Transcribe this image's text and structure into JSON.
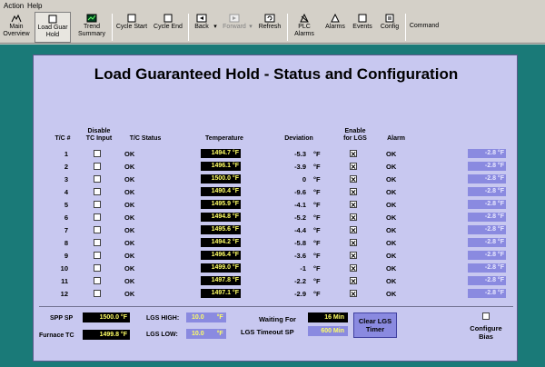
{
  "menu": {
    "action": "Action",
    "help": "Help"
  },
  "toolbar": [
    {
      "name": "main-overview",
      "l1": "Main",
      "l2": "Overview"
    },
    {
      "name": "load-guar-hold",
      "l1": "Load Guar",
      "l2": "Hold"
    },
    {
      "name": "trend-summary",
      "l1": "Trend",
      "l2": "Summary"
    },
    {
      "name": "cycle-start",
      "l1": "Cycle Start",
      "l2": ""
    },
    {
      "name": "cycle-end",
      "l1": "Cycle End",
      "l2": ""
    },
    {
      "name": "back",
      "l1": "Back",
      "l2": ""
    },
    {
      "name": "forward",
      "l1": "Forward",
      "l2": ""
    },
    {
      "name": "refresh",
      "l1": "Refresh",
      "l2": ""
    },
    {
      "name": "plc-alarms",
      "l1": "PLC",
      "l2": "Alarms"
    },
    {
      "name": "alarms",
      "l1": "Alarms",
      "l2": ""
    },
    {
      "name": "events",
      "l1": "Events",
      "l2": ""
    },
    {
      "name": "config",
      "l1": "Config",
      "l2": ""
    },
    {
      "name": "command",
      "l1": "Command",
      "l2": ""
    }
  ],
  "title": "Load Guaranteed Hold - Status and Configuration",
  "headers": {
    "tc": "T/C #",
    "disable": "Disable\nTC Input",
    "status": "T/C Status",
    "temperature": "Temperature",
    "deviation": "Deviation",
    "enable": "Enable\nfor LGS",
    "alarm": "Alarm"
  },
  "rows": [
    {
      "tc": "1",
      "status": "OK",
      "temp": "1494.7 °F",
      "dev": "-5.3",
      "alarm": "OK",
      "bias": "-2.8 °F"
    },
    {
      "tc": "2",
      "status": "OK",
      "temp": "1496.1 °F",
      "dev": "-3.9",
      "alarm": "OK",
      "bias": "-2.8 °F"
    },
    {
      "tc": "3",
      "status": "OK",
      "temp": "1500.0 °F",
      "dev": "0",
      "alarm": "OK",
      "bias": "-2.8 °F"
    },
    {
      "tc": "4",
      "status": "OK",
      "temp": "1490.4 °F",
      "dev": "-9.6",
      "alarm": "OK",
      "bias": "-2.8 °F"
    },
    {
      "tc": "5",
      "status": "OK",
      "temp": "1495.9 °F",
      "dev": "-4.1",
      "alarm": "OK",
      "bias": "-2.8 °F"
    },
    {
      "tc": "6",
      "status": "OK",
      "temp": "1494.8 °F",
      "dev": "-5.2",
      "alarm": "OK",
      "bias": "-2.8 °F"
    },
    {
      "tc": "7",
      "status": "OK",
      "temp": "1495.6 °F",
      "dev": "-4.4",
      "alarm": "OK",
      "bias": "-2.8 °F"
    },
    {
      "tc": "8",
      "status": "OK",
      "temp": "1494.2 °F",
      "dev": "-5.8",
      "alarm": "OK",
      "bias": "-2.8 °F"
    },
    {
      "tc": "9",
      "status": "OK",
      "temp": "1496.4 °F",
      "dev": "-3.6",
      "alarm": "OK",
      "bias": "-2.8 °F"
    },
    {
      "tc": "10",
      "status": "OK",
      "temp": "1499.0 °F",
      "dev": "-1",
      "alarm": "OK",
      "bias": "-2.8 °F"
    },
    {
      "tc": "11",
      "status": "OK",
      "temp": "1497.8 °F",
      "dev": "-2.2",
      "alarm": "OK",
      "bias": "-2.8 °F"
    },
    {
      "tc": "12",
      "status": "OK",
      "temp": "1497.1 °F",
      "dev": "-2.9",
      "alarm": "OK",
      "bias": "-2.8 °F"
    }
  ],
  "dev_unit": "°F",
  "footer": {
    "spp_label": "SPP SP",
    "spp_value": "1500.0 °F",
    "furnace_label": "Furnace TC",
    "furnace_value": "1499.8 °F",
    "lgs_high_label": "LGS HIGH:",
    "lgs_high_value": "10.0",
    "lgs_high_unit": "°F",
    "lgs_low_label": "LGS LOW:",
    "lgs_low_value": "10.0",
    "lgs_low_unit": "°F",
    "waiting_label": "Waiting For",
    "waiting_value": "16 Min",
    "timeout_label": "LGS Timeout SP",
    "timeout_value": "600 Min",
    "clear_btn_l1": "Clear LGS",
    "clear_btn_l2": "Timer",
    "configure_l1": "Configure",
    "configure_l2": "Bias"
  }
}
